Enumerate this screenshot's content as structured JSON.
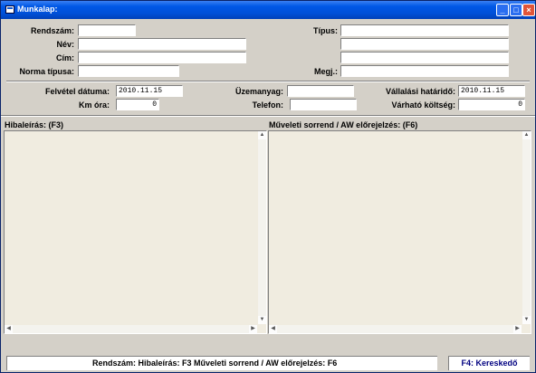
{
  "window": {
    "title": "Munkalap:"
  },
  "form": {
    "rendszam": {
      "label": "Rendszám:",
      "value": ""
    },
    "nev": {
      "label": "Név:",
      "value": ""
    },
    "cim": {
      "label": "Cím:",
      "value": ""
    },
    "norma_tipusa": {
      "label": "Norma típusa:",
      "value": ""
    },
    "tipus": {
      "label": "Típus:",
      "value": ""
    },
    "extra_1": {
      "value": ""
    },
    "extra_2": {
      "value": ""
    },
    "megj": {
      "label": "Megj.:",
      "value": ""
    },
    "felvetel_datuma": {
      "label": "Felvétel dátuma:",
      "value": "2010.11.15"
    },
    "km_ora": {
      "label": "Km óra:",
      "value": "0"
    },
    "uzemanyag": {
      "label": "Üzemanyag:",
      "value": ""
    },
    "telefon": {
      "label": "Telefon:",
      "value": ""
    },
    "vallalasi_hatarido": {
      "label": "Vállalási határidő:",
      "value": "2010.11.15"
    },
    "varhato_koltseg": {
      "label": "Várható költség:",
      "value": "0"
    }
  },
  "panels": {
    "hibaleiras": {
      "title": "Hibaleírás:  (F3)",
      "value": ""
    },
    "muveleti": {
      "title": "Műveleti sorrend / AW előrejelzés:  (F6)",
      "value": ""
    }
  },
  "status": {
    "main": "Rendszám:       Hibaleírás: F3   Műveleti sorrend / AW előrejelzés: F6",
    "right": "F4: Kereskedő",
    "right_color": "#000080"
  }
}
